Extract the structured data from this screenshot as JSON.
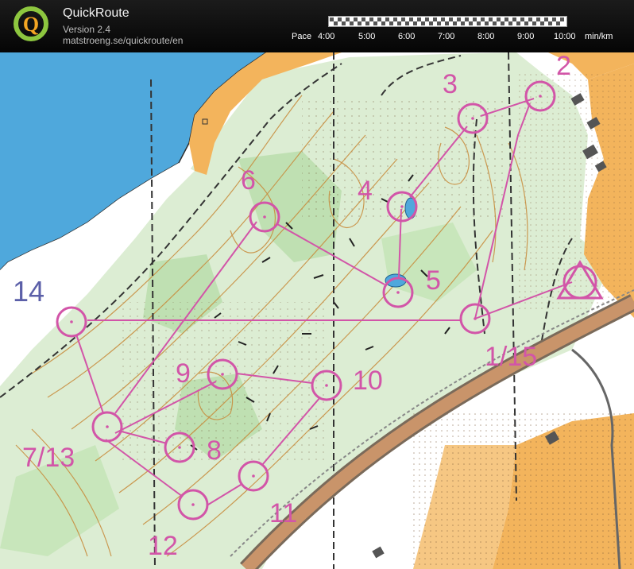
{
  "app": {
    "name": "QuickRoute",
    "version": "Version 2.4",
    "url": "matstroeng.se/quickroute/en"
  },
  "pace_scale": {
    "label": "Pace",
    "ticks": [
      "4:00",
      "5:00",
      "6:00",
      "7:00",
      "8:00",
      "9:00",
      "10:00"
    ],
    "unit": "min/km"
  },
  "map": {
    "course_color": "#d255a8",
    "labels": [
      "2",
      "3",
      "4",
      "5",
      "6",
      "9",
      "10",
      "8",
      "11",
      "12",
      "14",
      "7/13",
      "1/15"
    ],
    "colors": {
      "forest": "#d9ecd2",
      "open_land": "#f3b45c",
      "water": "#4fa8dc",
      "contour": "#c88a3a",
      "railway": "#c9946a"
    }
  }
}
